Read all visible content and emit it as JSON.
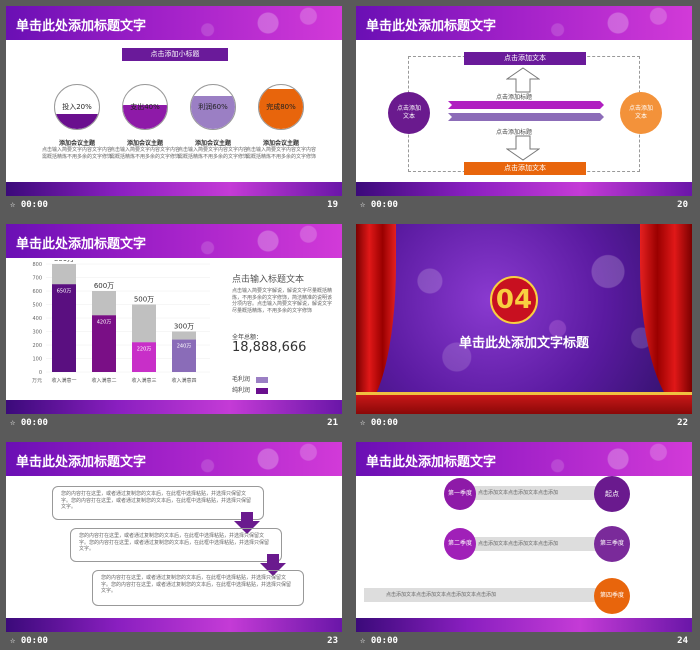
{
  "footer_time": "00:00",
  "slides": {
    "s19": {
      "num": "19",
      "title": "单击此处添加标题文字",
      "subtitle": "点击添加小标题",
      "circles": [
        {
          "label": "投入20%",
          "fill": 0.35,
          "color": "#6a0f8e"
        },
        {
          "label": "支出40%",
          "fill": 0.55,
          "color": "#8e1aa8"
        },
        {
          "label": "利润60%",
          "fill": 0.75,
          "color": "#9b7fc4"
        },
        {
          "label": "完成80%",
          "fill": 0.9,
          "color": "#e8650c"
        }
      ],
      "topic": "添加会议主题",
      "desc": "点击输入简要文字内容文字内容需概括精炼不用多余的文字修饰"
    },
    "s20": {
      "num": "20",
      "box_top": "点击添加文本",
      "box_bottom": "点击添加文本",
      "title_upper": "点击添加标题",
      "title_lower": "点击添加标题",
      "left_circle": "点击添加文本",
      "right_circle": "点击添加文本"
    },
    "s21": {
      "num": "21",
      "title": "单击此处添加标题文字",
      "chart_data": {
        "type": "bar",
        "categories": [
          "收入满意一",
          "收入满意二",
          "收入满意三",
          "收入满意四"
        ],
        "series": [
          {
            "name": "毛利润",
            "values": [
              800,
              600,
              500,
              300
            ]
          },
          {
            "name": "纯利润",
            "values": [
              650,
              420,
              220,
              240
            ]
          }
        ],
        "value_labels_top": [
          "800万",
          "600万",
          "500万",
          "300万"
        ],
        "value_labels_inner": [
          "650万",
          "420万",
          "220万",
          "240万"
        ],
        "ylim": [
          0,
          800
        ],
        "yticks": [
          "800",
          "700",
          "600",
          "500",
          "400",
          "300",
          "200",
          "100",
          "0"
        ],
        "ylabel": "万元"
      },
      "side_title": "点击输入标题文本",
      "side_text": "点击输入简要文字解说，解说文字尽量概括精炼，不用多余的文字修饰，简洁精准的说明该分项内容。点击输入简要文字解说，解说文字尽量概括精炼，不用多余的文字修饰",
      "total_label": "全年总额：",
      "total_value": "18,888,666",
      "legend": [
        "毛利润",
        "纯利润"
      ]
    },
    "s22": {
      "num": "22",
      "badge": "04",
      "title": "单击此处添加文字标题"
    },
    "s23": {
      "num": "23",
      "title": "单击此处添加标题文字",
      "boxes": [
        "您的内容打在这里，或者通过复制您的文本后，在此框中选择粘贴，并选择只保留文字。您的内容打在这里，或者通过复制您的文本后，在此框中选择粘贴，并选择只保留文字。",
        "您的内容打在这里，或者通过复制您的文本后，在此框中选择粘贴，并选择只保留文字。您的内容打在这里，或者通过复制您的文本后，在此框中选择粘贴，并选择只保留文字。",
        "您的内容打在这里，或者通过复制您的文本后，在此框中选择粘贴，并选择只保留文字。您的内容打在这里，或者通过复制您的文本后，在此框中选择粘贴，并选择只保留文字。"
      ]
    },
    "s24": {
      "num": "24",
      "title": "单击此处添加标题文字",
      "q1": "第一季度",
      "q2": "第二季度",
      "q3": "第三季度",
      "q4": "第四季度",
      "start": "起点",
      "row1": "点击添加文本点击添加文本点击添加",
      "row2": "点击添加文本点击添加文本点击添加",
      "row3": "点击添加文本点击添加文本点击添加文本点击添加"
    }
  }
}
